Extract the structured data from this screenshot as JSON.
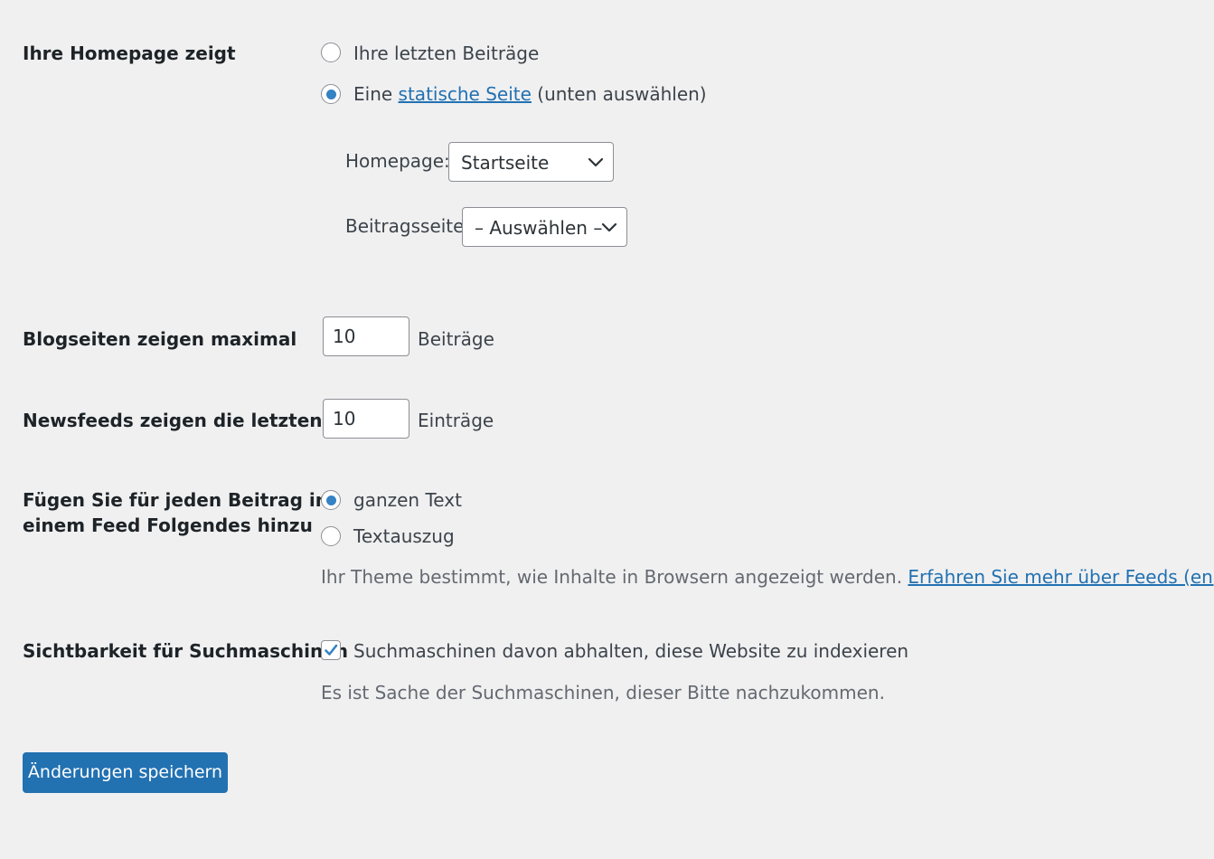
{
  "homepage_shows": {
    "label": "Ihre Homepage zeigt",
    "option_latest_posts": "Ihre letzten Beiträge",
    "option_static_prefix": "Eine",
    "option_static_link": "statische Seite",
    "option_static_suffix": "(unten auswählen)",
    "selected": "static",
    "homepage_label": "Homepage:",
    "homepage_value": "Startseite",
    "posts_page_label": "Beitragsseite:",
    "posts_page_value": "– Auswählen –"
  },
  "blog_pages": {
    "label": "Blogseiten zeigen maximal",
    "value": "10",
    "unit": "Beiträge"
  },
  "newsfeeds": {
    "label": "Newsfeeds zeigen die letzten",
    "value": "10",
    "unit": "Einträge"
  },
  "feed_content": {
    "label_line1": "Fügen Sie für jeden Beitrag in",
    "label_line2": "einem Feed Folgendes hinzu",
    "option_full_text": "ganzen Text",
    "option_excerpt": "Textauszug",
    "selected": "full_text",
    "description": "Ihr Theme bestimmt, wie Inhalte in Browsern angezeigt werden.",
    "description_link": "Erfahren Sie mehr über Feeds (engl.)",
    "description_link_suffix": "."
  },
  "search_visibility": {
    "label": "Sichtbarkeit für Suchmaschinen",
    "checkbox_label": "Suchmaschinen davon abhalten, diese Website zu indexieren",
    "checked": true,
    "description": "Es ist Sache der Suchmaschinen, dieser Bitte nachzukommen."
  },
  "save_button": "Änderungen speichern",
  "colors": {
    "background": "#f0f0f1",
    "accent": "#2271b1",
    "radio_dot": "#3582c4",
    "text": "#1d2327",
    "muted": "#646970"
  }
}
